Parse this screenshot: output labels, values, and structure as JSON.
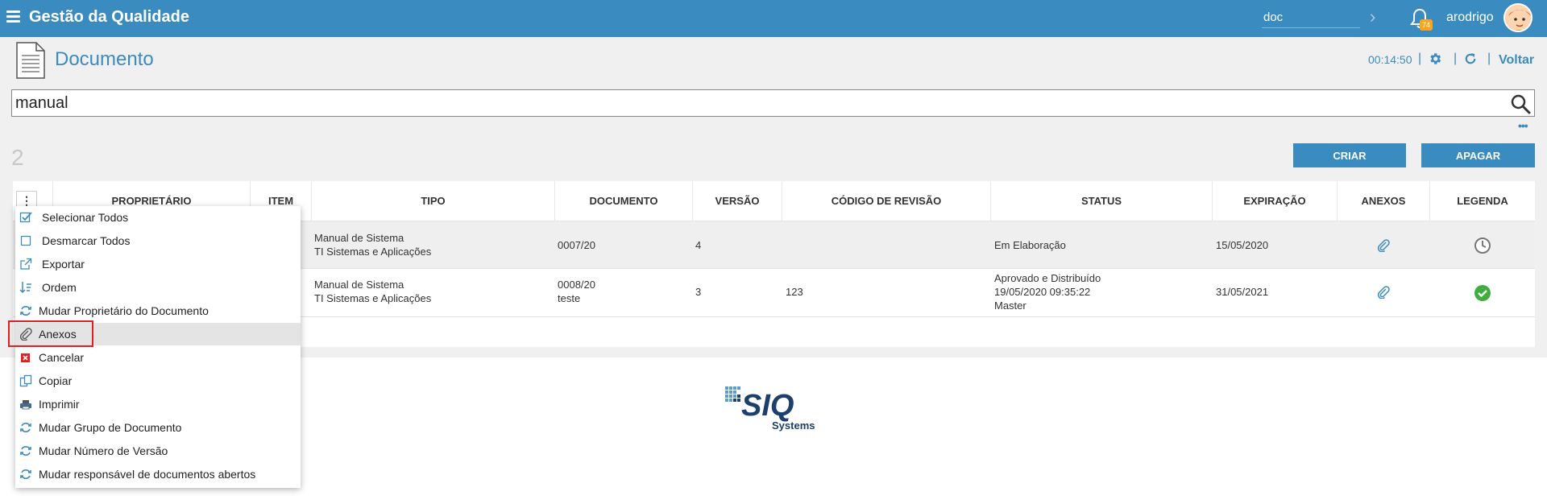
{
  "header": {
    "app_title": "Gestão da Qualidade",
    "search_value": "doc",
    "notification_count": "74",
    "username": "arodrigo"
  },
  "page": {
    "title": "Documento",
    "timer": "00:14:50",
    "back_label": "Voltar",
    "search_value": "manual",
    "result_count": "2",
    "criar_label": "CRIAR",
    "apagar_label": "APAGAR"
  },
  "table": {
    "columns": [
      "PROPRIETÁRIO",
      "ITEM",
      "TIPO",
      "DOCUMENTO",
      "VERSÃO",
      "CÓDIGO DE REVISÃO",
      "STATUS",
      "EXPIRAÇÃO",
      "ANEXOS",
      "LEGENDA"
    ],
    "rows": [
      {
        "tipo_line1": "Manual de Sistema",
        "tipo_line2": "TI Sistemas e Aplicações",
        "documento_line1": "0007/20",
        "documento_line2": "",
        "versao": "4",
        "codigo_revisao": "",
        "status_line1": "Em Elaboração",
        "status_line2": "",
        "status_line3": "",
        "expiracao": "15/05/2020",
        "legenda_icon": "clock-icon"
      },
      {
        "tipo_line1": "Manual de Sistema",
        "tipo_line2": "TI Sistemas e Aplicações",
        "documento_line1": "0008/20",
        "documento_line2": "teste",
        "versao": "3",
        "codigo_revisao": "123",
        "status_line1": "Aprovado e Distribuído",
        "status_line2": "19/05/2020 09:35:22",
        "status_line3": "Master",
        "expiracao": "31/05/2021",
        "legenda_icon": "check-circle-icon"
      }
    ]
  },
  "menu": {
    "items": [
      {
        "label": "Selecionar Todos",
        "icon": "checkbox-checked-icon"
      },
      {
        "label": "Desmarcar Todos",
        "icon": "checkbox-empty-icon"
      },
      {
        "label": "Exportar",
        "icon": "external-link-icon"
      },
      {
        "label": "Ordem",
        "icon": "sort-icon"
      },
      {
        "label": "Mudar Proprietário do Documento",
        "icon": "sync-icon"
      },
      {
        "label": "Anexos",
        "icon": "paperclip-icon"
      },
      {
        "label": "Cancelar",
        "icon": "cancel-icon"
      },
      {
        "label": "Copiar",
        "icon": "copy-icon"
      },
      {
        "label": "Imprimir",
        "icon": "printer-icon"
      },
      {
        "label": "Mudar Grupo de Documento",
        "icon": "sync-icon"
      },
      {
        "label": "Mudar Número de Versão",
        "icon": "sync-icon"
      },
      {
        "label": "Mudar responsável de documentos abertos",
        "icon": "sync-icon"
      }
    ],
    "highlighted_item": "Anexos"
  },
  "footer": {
    "logo_text": "SIQ",
    "logo_subtext": "Systems"
  },
  "colors": {
    "primary": "#3a8bbf",
    "success": "#3fae3f",
    "danger": "#e02020"
  }
}
